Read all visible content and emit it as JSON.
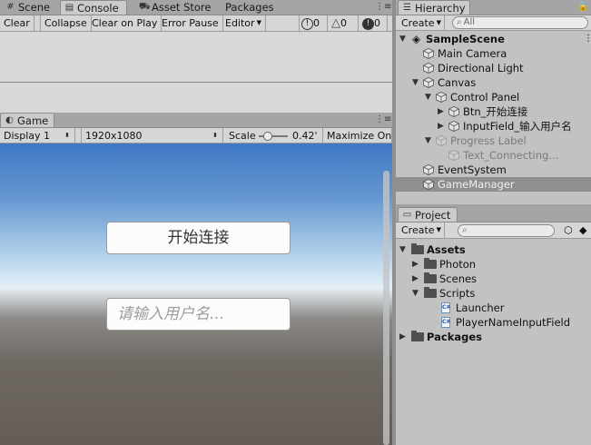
{
  "console_panel": {
    "tabs": [
      {
        "label": "Scene",
        "icon": "scene-icon"
      },
      {
        "label": "Console",
        "icon": "console-icon"
      },
      {
        "label": "Asset Store",
        "icon": "asset-store-icon"
      },
      {
        "label": "Packages",
        "icon": ""
      }
    ],
    "toolbar": {
      "clear": "Clear",
      "collapse": "Collapse",
      "clear_on_play": "Clear on Play",
      "error_pause": "Error Pause",
      "editor": "Editor",
      "info_count": "0",
      "warning_count": "0",
      "error_count": "0"
    }
  },
  "game_panel": {
    "tab": "Game",
    "display": "Display 1",
    "resolution": "1920x1080",
    "scale_label": "Scale",
    "scale_value": "0.42'",
    "maximize": "Maximize On P",
    "button_text": "开始连接",
    "input_placeholder": "请输入用户名...",
    "scale_level": 0.2
  },
  "hierarchy": {
    "tab": "Hierarchy",
    "create": "Create",
    "search_placeholder": "All",
    "scene": "SampleScene",
    "items": [
      {
        "label": "Main Camera",
        "depth": 1,
        "arrow": "",
        "dim": false,
        "selected": false
      },
      {
        "label": "Directional Light",
        "depth": 1,
        "arrow": "",
        "dim": false,
        "selected": false
      },
      {
        "label": "Canvas",
        "depth": 1,
        "arrow": "down",
        "dim": false,
        "selected": false
      },
      {
        "label": "Control Panel",
        "depth": 2,
        "arrow": "down",
        "dim": false,
        "selected": false
      },
      {
        "label": "Btn_开始连接",
        "depth": 3,
        "arrow": "right",
        "dim": false,
        "selected": false
      },
      {
        "label": "InputField_输入用户名",
        "depth": 3,
        "arrow": "right",
        "dim": false,
        "selected": false
      },
      {
        "label": "Progress Label",
        "depth": 2,
        "arrow": "down",
        "dim": true,
        "selected": false
      },
      {
        "label": "Text_Connecting...",
        "depth": 3,
        "arrow": "",
        "dim": true,
        "selected": false
      },
      {
        "label": "EventSystem",
        "depth": 1,
        "arrow": "",
        "dim": false,
        "selected": false
      },
      {
        "label": "GameManager",
        "depth": 1,
        "arrow": "",
        "dim": false,
        "selected": true
      }
    ]
  },
  "project": {
    "tab": "Project",
    "create": "Create",
    "items": [
      {
        "label": "Assets",
        "type": "folder",
        "depth": 0,
        "arrow": "down",
        "bold": true
      },
      {
        "label": "Photon",
        "type": "folder",
        "depth": 1,
        "arrow": "right",
        "bold": false
      },
      {
        "label": "Scenes",
        "type": "folder",
        "depth": 1,
        "arrow": "right",
        "bold": false
      },
      {
        "label": "Scripts",
        "type": "folder",
        "depth": 1,
        "arrow": "down",
        "bold": false
      },
      {
        "label": "Launcher",
        "type": "script",
        "depth": 2,
        "arrow": "",
        "bold": false
      },
      {
        "label": "PlayerNameInputField",
        "type": "script",
        "depth": 2,
        "arrow": "",
        "bold": false
      },
      {
        "label": "Packages",
        "type": "folder",
        "depth": 0,
        "arrow": "right",
        "bold": true
      }
    ]
  },
  "colors": {
    "selection": "#8f8f8f",
    "panel_bg": "#c2c2c2",
    "unity_blue": "#2b5c9e"
  }
}
